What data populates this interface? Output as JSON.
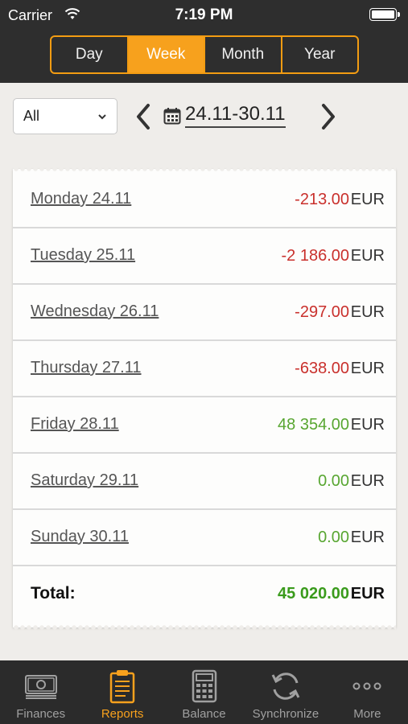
{
  "status_bar": {
    "carrier": "Carrier",
    "time": "7:19 PM"
  },
  "period_tabs": [
    {
      "label": "Day"
    },
    {
      "label": "Week",
      "active": true
    },
    {
      "label": "Month"
    },
    {
      "label": "Year"
    }
  ],
  "filter": {
    "selected": "All"
  },
  "date_range": "24.11-30.11",
  "rows": [
    {
      "day": "Monday 24.11",
      "amount": "-213.00",
      "currency": "EUR",
      "sign": "negative"
    },
    {
      "day": "Tuesday 25.11",
      "amount": "-2 186.00",
      "currency": "EUR",
      "sign": "negative"
    },
    {
      "day": "Wednesday 26.11",
      "amount": "-297.00",
      "currency": "EUR",
      "sign": "negative"
    },
    {
      "day": "Thursday 27.11",
      "amount": "-638.00",
      "currency": "EUR",
      "sign": "negative"
    },
    {
      "day": "Friday 28.11",
      "amount": "48 354.00",
      "currency": "EUR",
      "sign": "positive"
    },
    {
      "day": "Saturday 29.11",
      "amount": "0.00",
      "currency": "EUR",
      "sign": "positive"
    },
    {
      "day": "Sunday 30.11",
      "amount": "0.00",
      "currency": "EUR",
      "sign": "positive"
    }
  ],
  "total": {
    "label": "Total:",
    "amount": "45 020.00",
    "currency": "EUR"
  },
  "tab_bar": [
    {
      "label": "Finances",
      "icon": "money-icon"
    },
    {
      "label": "Reports",
      "icon": "clipboard-icon",
      "active": true
    },
    {
      "label": "Balance",
      "icon": "calculator-icon"
    },
    {
      "label": "Synchronize",
      "icon": "sync-icon"
    },
    {
      "label": "More",
      "icon": "more-icon"
    }
  ],
  "colors": {
    "accent": "#f7a11d",
    "negative": "#c9302c",
    "positive": "#58a631",
    "header": "#2e2e2e"
  }
}
